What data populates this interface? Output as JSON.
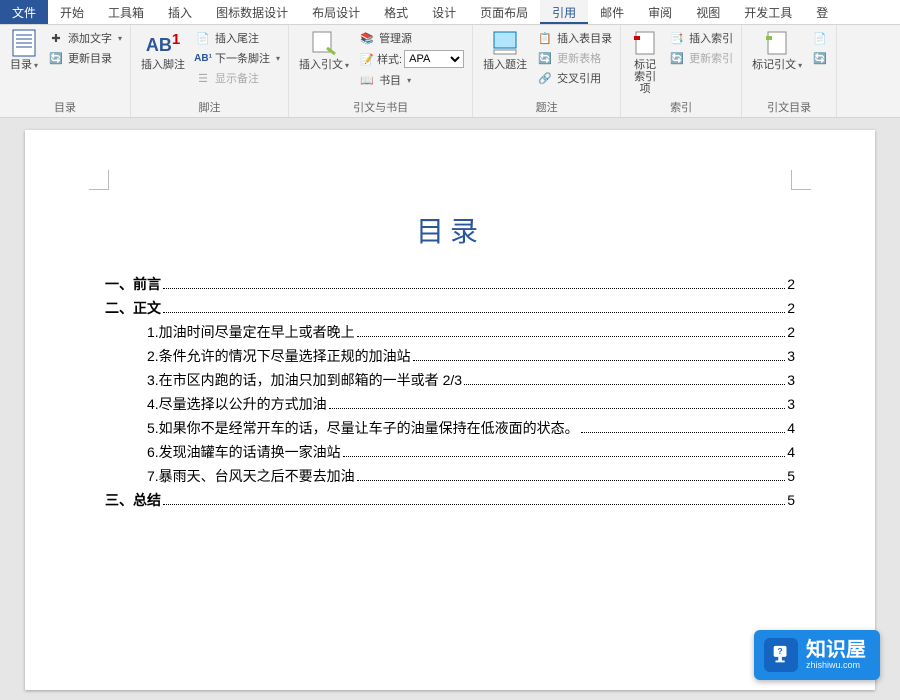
{
  "menu": {
    "file": "文件",
    "tabs": [
      "开始",
      "工具箱",
      "插入",
      "图标数据设计",
      "布局设计",
      "格式",
      "设计",
      "页面布局",
      "引用",
      "邮件",
      "审阅",
      "视图",
      "开发工具",
      "登"
    ],
    "active": "引用"
  },
  "ribbon": {
    "toc": {
      "label": "目录",
      "btn": "目录",
      "add_text": "添加文字",
      "update": "更新目录"
    },
    "footnotes": {
      "label": "脚注",
      "insert": "插入脚注",
      "endnote": "插入尾注",
      "next": "下一条脚注",
      "show": "显示备注"
    },
    "citations": {
      "label": "引文与书目",
      "insert": "插入引文",
      "manage": "管理源",
      "style_lbl": "样式:",
      "style_val": "APA",
      "biblio": "书目"
    },
    "captions": {
      "label": "题注",
      "insert": "插入题注",
      "tof": "插入表目录",
      "update": "更新表格",
      "xref": "交叉引用"
    },
    "index": {
      "label": "索引",
      "mark": "标记索引项",
      "insert": "插入索引",
      "update": "更新索引"
    },
    "toa": {
      "label": "引文目录",
      "mark": "标记引文"
    }
  },
  "document": {
    "title": "目录",
    "toc": [
      {
        "level": 1,
        "text": "一、前言",
        "page": "2",
        "bold": true
      },
      {
        "level": 1,
        "text": "二、正文",
        "page": "2",
        "bold": true
      },
      {
        "level": 2,
        "text": "1.加油时间尽量定在早上或者晚上",
        "page": "2"
      },
      {
        "level": 2,
        "text": "2.条件允许的情况下尽量选择正规的加油站",
        "page": "3"
      },
      {
        "level": 2,
        "text": "3.在市区内跑的话，加油只加到邮箱的一半或者 2/3",
        "page": "3"
      },
      {
        "level": 2,
        "text": "4.尽量选择以公升的方式加油",
        "page": "3"
      },
      {
        "level": 2,
        "text": "5.如果你不是经常开车的话，尽量让车子的油量保持在低液面的状态。",
        "page": "4"
      },
      {
        "level": 2,
        "text": "6.发现油罐车的话请换一家油站",
        "page": "4"
      },
      {
        "level": 2,
        "text": "7.暴雨天、台风天之后不要去加油",
        "page": "5"
      },
      {
        "level": 1,
        "text": "三、总结",
        "page": "5",
        "bold": true
      }
    ]
  },
  "badge": {
    "title": "知识屋",
    "sub": "zhishiwu.com"
  }
}
